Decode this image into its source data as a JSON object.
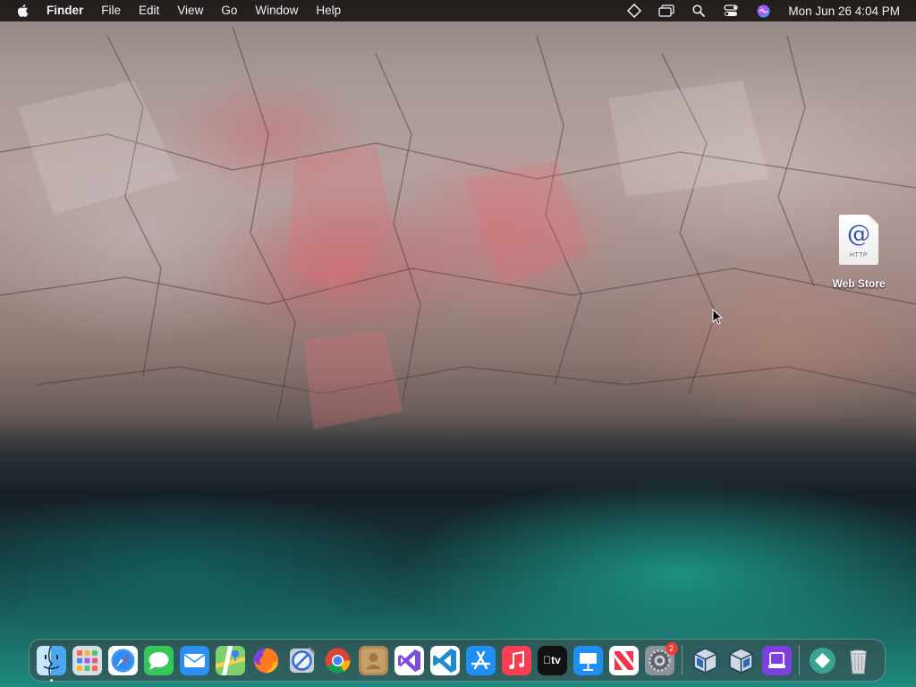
{
  "menubar": {
    "app_name": "Finder",
    "items": [
      "File",
      "Edit",
      "View",
      "Go",
      "Window",
      "Help"
    ],
    "clock": "Mon Jun 26  4:04 PM",
    "status_icons": [
      "diamond-icon",
      "window-switcher-icon",
      "spotlight-search-icon",
      "control-center-icon",
      "siri-icon"
    ]
  },
  "desktop_icon": {
    "label": "Web Store",
    "glyph": "@",
    "subtext": "HTTP"
  },
  "dock": {
    "apps": [
      {
        "name": "finder",
        "running": true
      },
      {
        "name": "launchpad"
      },
      {
        "name": "safari"
      },
      {
        "name": "messages"
      },
      {
        "name": "mail"
      },
      {
        "name": "maps"
      },
      {
        "name": "firefox"
      },
      {
        "name": "no-entry-app"
      },
      {
        "name": "chrome"
      },
      {
        "name": "contacts"
      },
      {
        "name": "visual-studio"
      },
      {
        "name": "vscode"
      },
      {
        "name": "app-store"
      },
      {
        "name": "music"
      },
      {
        "name": "apple-tv",
        "label": "tv"
      },
      {
        "name": "keynote"
      },
      {
        "name": "news"
      },
      {
        "name": "system-settings",
        "badge": "2"
      },
      {
        "name": "virtualbox-1"
      },
      {
        "name": "virtualbox-2"
      },
      {
        "name": "purple-app"
      },
      {
        "name": "teal-app"
      },
      {
        "name": "trash"
      }
    ]
  },
  "colors": {
    "menubar_bg": "#1c1616",
    "badge_red": "#f03a35",
    "water_teal": "#1d8a80",
    "rock_pink": "#d75f69"
  }
}
